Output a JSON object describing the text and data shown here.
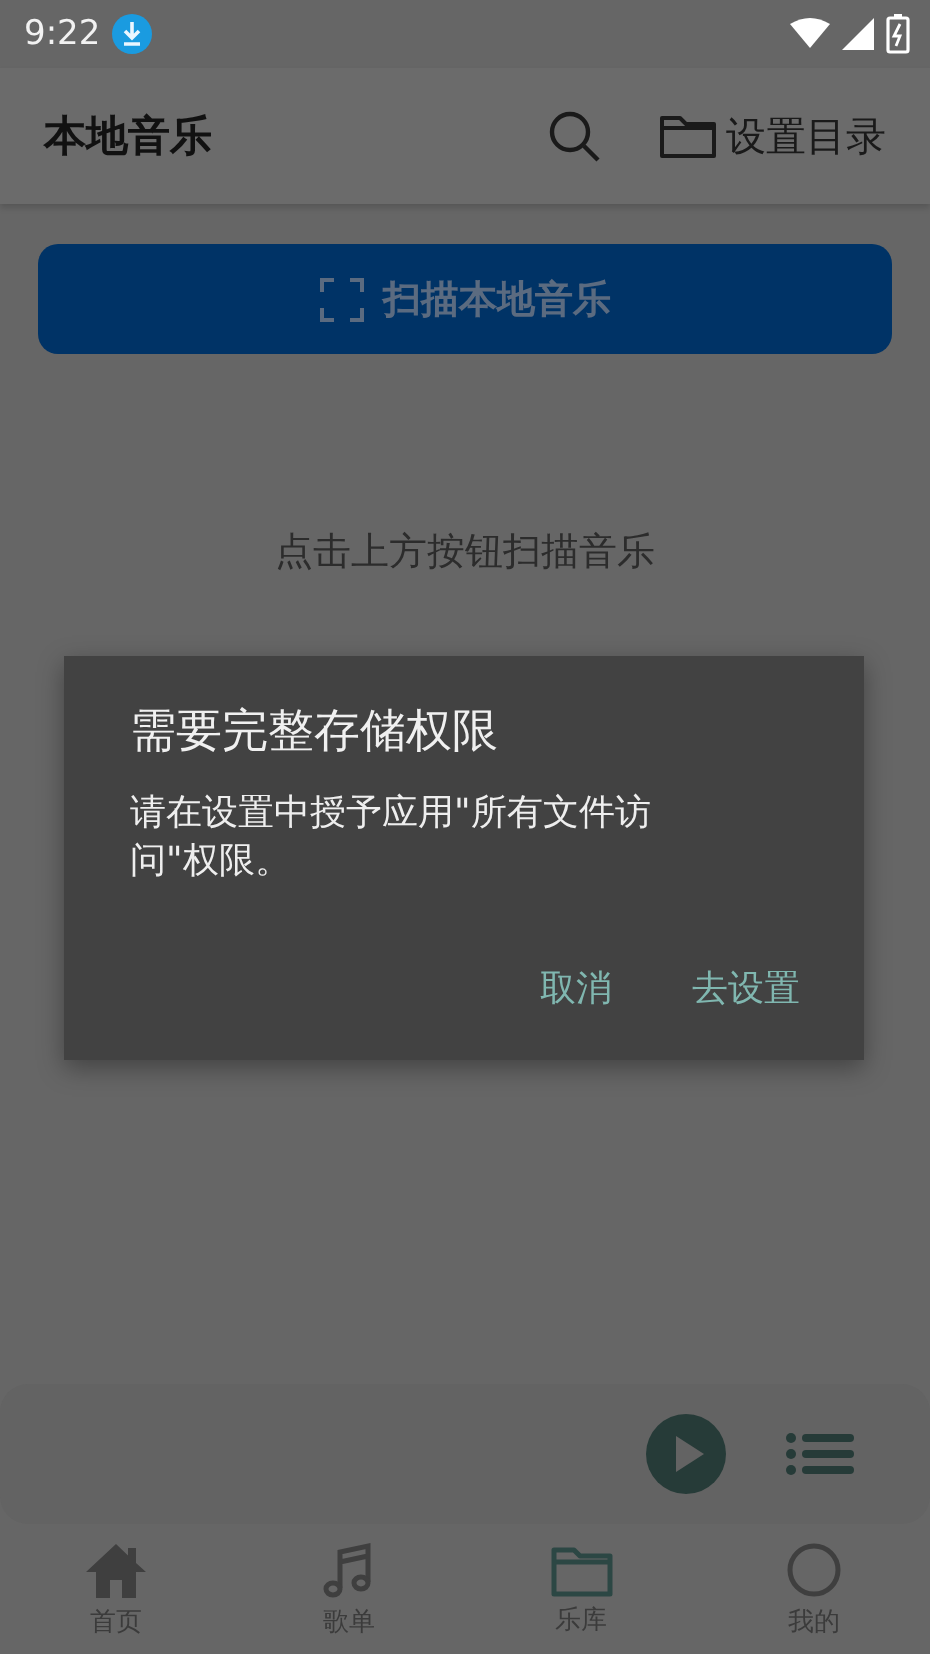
{
  "status_bar": {
    "time": "9:22"
  },
  "app_bar": {
    "title": "本地音乐",
    "folder_button": "设置目录"
  },
  "scan_button": {
    "label": "扫描本地音乐"
  },
  "empty_hint": "点击上方按钮扫描音乐",
  "dialog": {
    "title": "需要完整存储权限",
    "message": "请在设置中授予应用\"所有文件访问\"权限。",
    "buttons": [
      "取消",
      "去设置"
    ]
  },
  "bottom_nav": [
    {
      "label": "首页",
      "selected": false
    },
    {
      "label": "歌单",
      "selected": false
    },
    {
      "label": "乐库",
      "selected": true
    },
    {
      "label": "我的",
      "selected": false
    }
  ]
}
